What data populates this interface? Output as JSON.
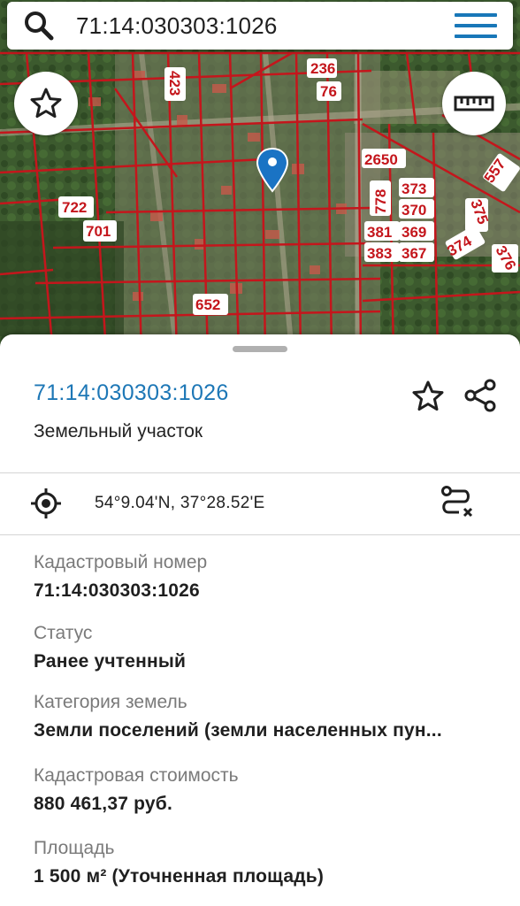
{
  "search": {
    "query": "71:14:030303:1026"
  },
  "map": {
    "labels": [
      "236",
      "76",
      "423",
      "2650",
      "557",
      "778",
      "373",
      "370",
      "381",
      "369",
      "383",
      "367",
      "375",
      "374",
      "722",
      "701",
      "652",
      "376"
    ]
  },
  "card": {
    "title": "71:14:030303:1026",
    "subtitle": "Земельный участок",
    "coordinates": "54°9.04'N, 37°28.52'E"
  },
  "details": [
    {
      "label": "Кадастровый номер",
      "value": "71:14:030303:1026"
    },
    {
      "label": "Статус",
      "value": "Ранее учтенный"
    },
    {
      "label": "Категория земель",
      "value": "Земли поселений (земли населенных пун..."
    },
    {
      "label": "Кадастровая стоимость",
      "value": "880 461,37 руб."
    },
    {
      "label": "Площадь",
      "value": "1 500 м² (Уточненная площадь)"
    }
  ],
  "colors": {
    "accent": "#1d77b6",
    "parcel_border": "#c4161c",
    "marker": "#1a73c4"
  }
}
